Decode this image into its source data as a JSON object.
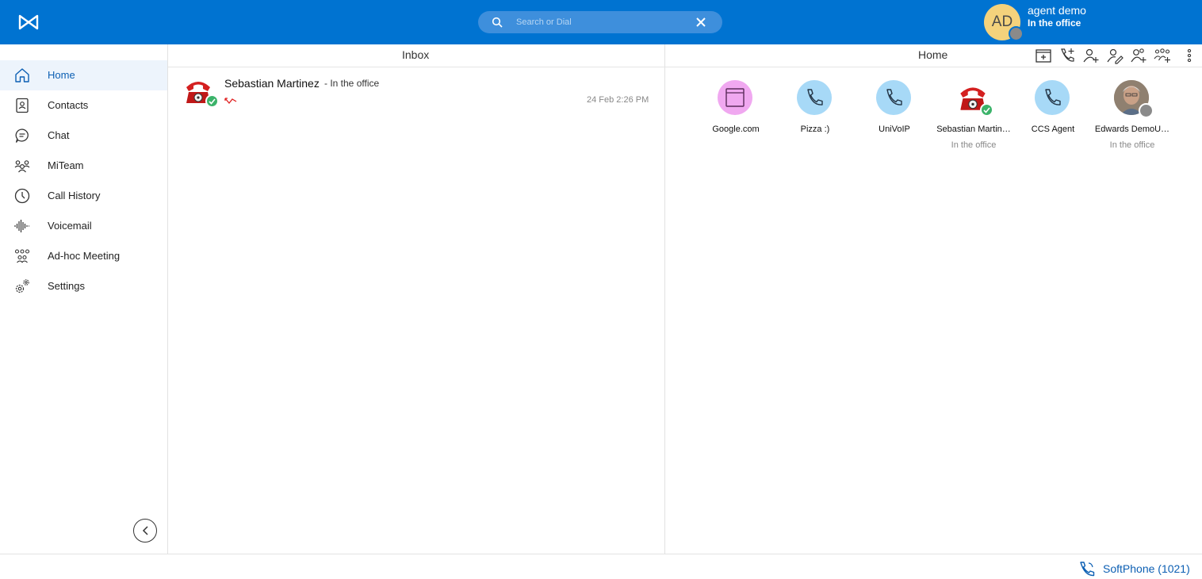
{
  "app": {
    "logo": "mitel-logo-icon"
  },
  "search": {
    "placeholder": "Search or Dial"
  },
  "user": {
    "initials": "AD",
    "name": "agent demo",
    "status": "In the office",
    "presence_color": "#8a8a8a"
  },
  "sidebar": {
    "items": [
      {
        "label": "Home",
        "icon": "home-icon"
      },
      {
        "label": "Contacts",
        "icon": "contacts-book-icon"
      },
      {
        "label": "Chat",
        "icon": "chat-bubble-icon"
      },
      {
        "label": "MiTeam",
        "icon": "team-icon"
      },
      {
        "label": "Call History",
        "icon": "clock-icon"
      },
      {
        "label": "Voicemail",
        "icon": "voicemail-waveform-icon"
      },
      {
        "label": "Ad-hoc Meeting",
        "icon": "meeting-group-icon"
      },
      {
        "label": "Settings",
        "icon": "gears-icon"
      }
    ],
    "active": "Home"
  },
  "inbox": {
    "title": "Inbox",
    "items": [
      {
        "name": "Sebastian Martinez",
        "status": "- In the office",
        "time": "24 Feb 2:26 PM",
        "event": "missed-call-icon"
      }
    ]
  },
  "home": {
    "title": "Home",
    "toolbar": [
      "add-tile-icon",
      "add-call-icon",
      "add-contact-icon",
      "edit-contact-icon",
      "add-user-icon",
      "add-group-icon",
      "more-options-icon"
    ],
    "favorites": [
      {
        "name": "Google.com",
        "status": "",
        "type": "web"
      },
      {
        "name": "Pizza :)",
        "status": "",
        "type": "phone"
      },
      {
        "name": "UniVoIP",
        "status": "",
        "type": "phone"
      },
      {
        "name": "Sebastian Martin…",
        "status": "In the office",
        "type": "person-red"
      },
      {
        "name": "CCS Agent",
        "status": "",
        "type": "phone"
      },
      {
        "name": "Edwards DemoU…",
        "status": "In the office",
        "type": "person-photo"
      }
    ]
  },
  "footer": {
    "softphone_label": "SoftPhone (1021)"
  },
  "colors": {
    "brand": "#0073d1",
    "accent": "#0c5fb3",
    "presence_ok": "#3bb36a",
    "web_tile": "#f0a8f0",
    "phone_tile": "#a7d9f7",
    "missed": "#e02020"
  }
}
